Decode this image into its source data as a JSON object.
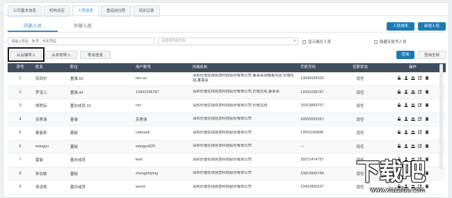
{
  "top_tabs": [
    "公司基本信息",
    "机构设定",
    "人员信息",
    "重返岗位职",
    "培训记录"
  ],
  "active_top_tab": 2,
  "sub_tabs": [
    "内部人员",
    "外部人员"
  ],
  "header_buttons": {
    "sort": "人员排序",
    "add": "新增人员"
  },
  "search": {
    "keyword_placeholder": "请输入姓名、账号、手机号码",
    "org_placeholder": "请选择所属机构"
  },
  "checkboxes": {
    "show_resigned": "显示离任人员",
    "hide_no_account": "隐藏无账号人员"
  },
  "action_buttons": {
    "import_cloud": "从云端导入",
    "import_local": "从本地导入",
    "export": "导出信息",
    "query": "查询",
    "query_all": "查询全部"
  },
  "table": {
    "headers": [
      "序号",
      "姓名",
      "职位",
      "用户账号",
      "所属机构",
      "手机号码",
      "任职状态",
      "操作"
    ],
    "rows": [
      {
        "num": "1",
        "name": "苏同尔",
        "position": "董事,55",
        "account": "nier.su",
        "org": "深圳价值在线信息科技股份有限公司,董事会战略委员会,价值在线,董事会",
        "phone": "13640935020",
        "status": "现任"
      },
      {
        "num": "2",
        "name": "罗宝儿",
        "position": "董事,44",
        "account": "13431036787",
        "org": "深圳价值在线信息科技股份有限公司,价值在线,董事会",
        "phone": "13431036787",
        "status": "现任"
      },
      {
        "num": "3",
        "name": "胡思纭",
        "position": "董办成员,33",
        "account": "cici",
        "org": "深圳价值在线信息科技股份有限公司,价值在线",
        "phone": "15919869757",
        "status": "现任"
      },
      {
        "num": "4",
        "name": "苏秀清",
        "position": "董事",
        "account": "苏秀清",
        "org": "深圳价值在线信息科技股份有限公司",
        "phone": "18555555557",
        "status": "现任"
      },
      {
        "num": "5",
        "name": "蔡曼莉",
        "position": "董秘",
        "account": "caimanli",
        "org": "深圳价值在线信息科技股份有限公司",
        "phone": "13501166846",
        "status": "现任"
      },
      {
        "num": "6",
        "name": "wangyu",
        "position": "董秘",
        "account": "wangyu625",
        "org": "深圳价值在线信息科技股份有限公司",
        "phone": "---",
        "status": "现任"
      },
      {
        "num": "7",
        "name": "雷曼",
        "position": "董办成员",
        "account": "leim",
        "org": "深圳价值在线信息科技股份有限公司",
        "phone": "18271474757",
        "status": "现任"
      },
      {
        "num": "8",
        "name": "钟志颖",
        "position": "董秘",
        "account": "zhongzhiying",
        "org": "深圳价值在线信息科技股份有限公司",
        "phone": "13813942749",
        "status": "现任"
      },
      {
        "num": "9",
        "name": "吴泽筠",
        "position": "董办成员",
        "account": "wuzm",
        "org": "深圳价值在线信息科技股份有限公司",
        "phone": "13432800237",
        "status": "现任"
      }
    ]
  },
  "watermark": {
    "title": "下载吧",
    "url": "www.xiazaiba.com"
  },
  "colors": {
    "primary": "#1a7bb6",
    "header": "#3f4e5c",
    "active_tab": "#2f8fd2"
  }
}
